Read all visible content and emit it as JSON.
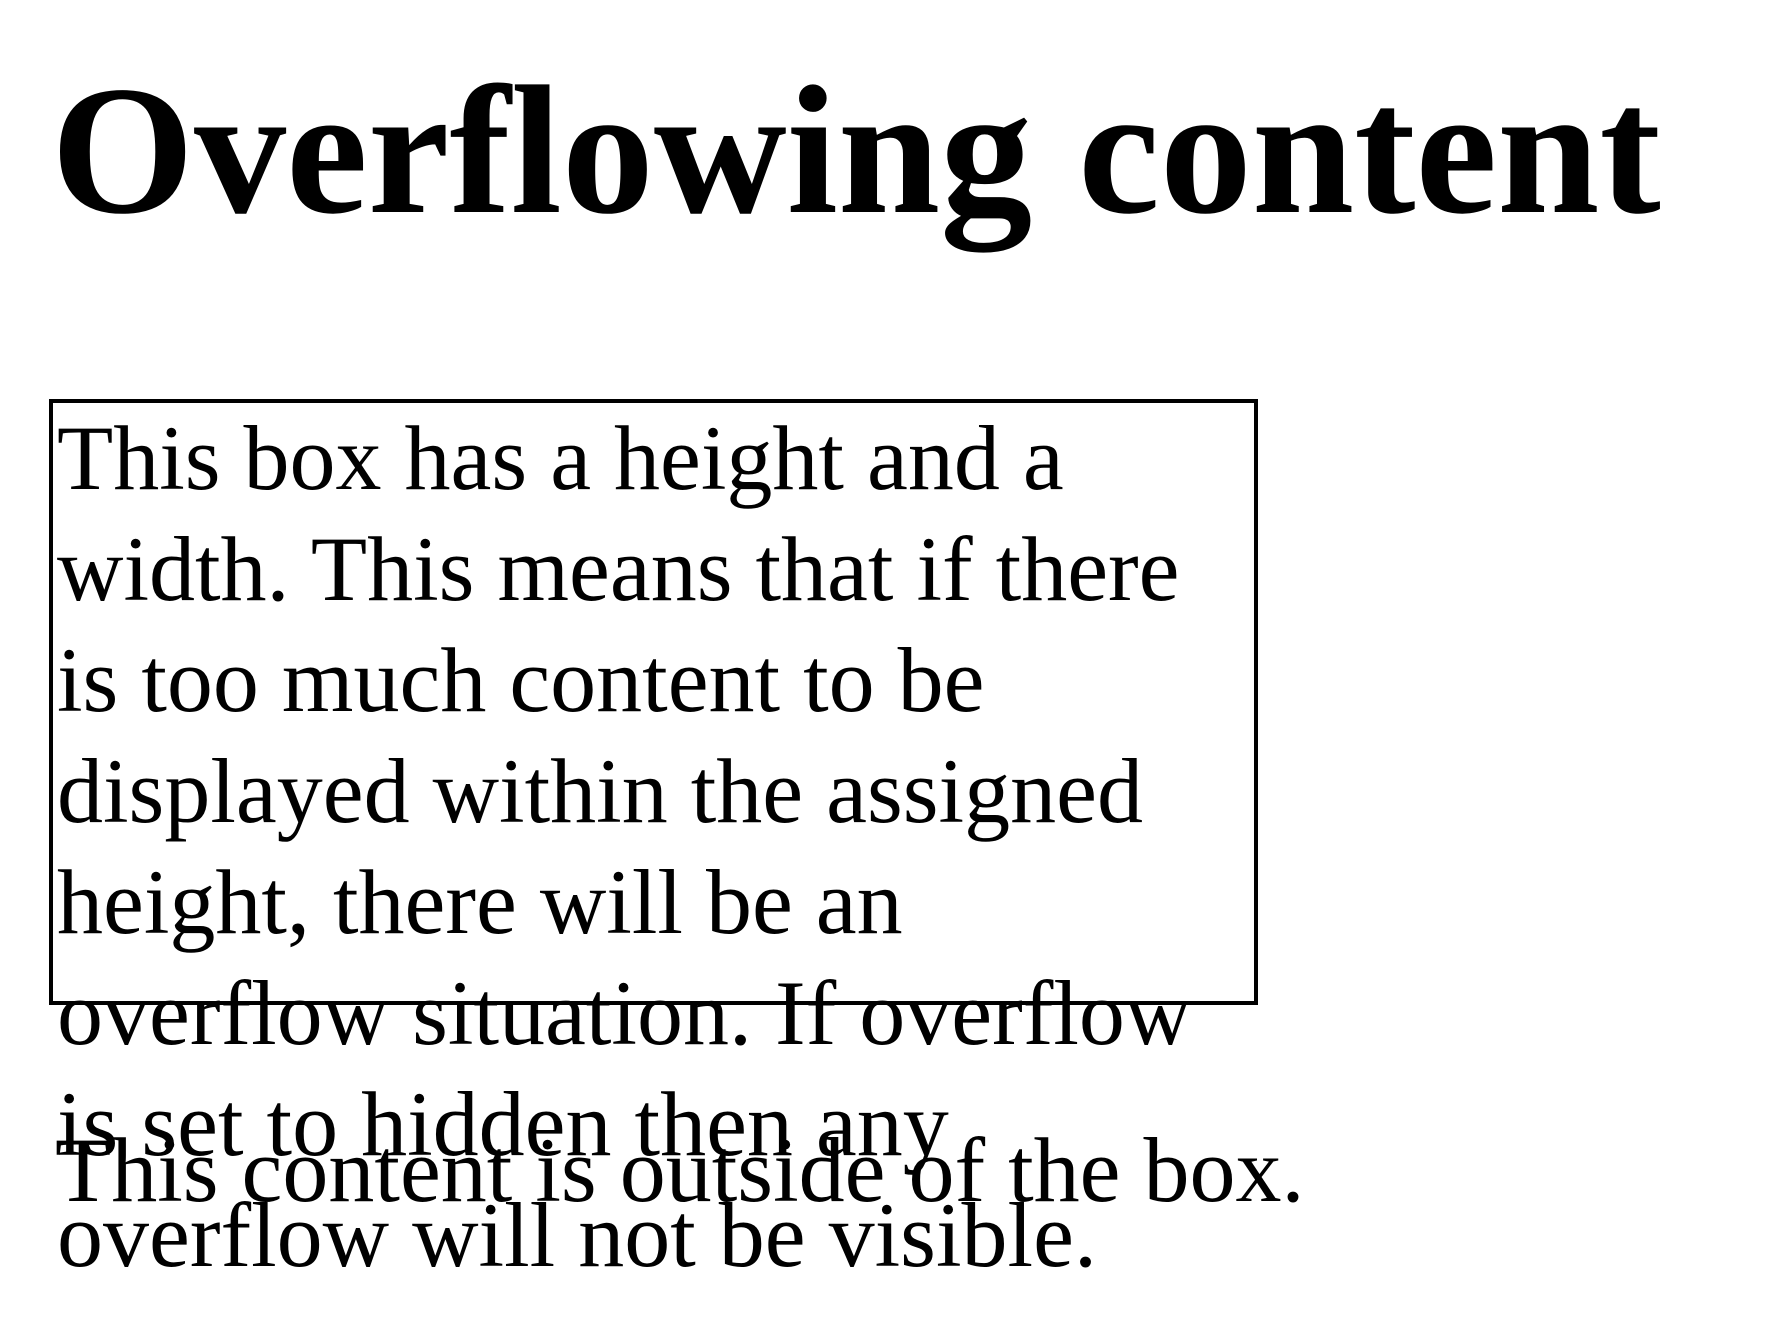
{
  "page": {
    "heading": "Overflowing content",
    "box_text": "This box has a height and a width. This means that if there is too much content to be displayed within the assigned height, there will be an overflow situation. If overflow is set to hidden then any overflow will not be visible.",
    "outside_text": "This content is outside of the box."
  },
  "colors": {
    "background": "#ffffff",
    "text": "#000000",
    "border": "#000000"
  }
}
